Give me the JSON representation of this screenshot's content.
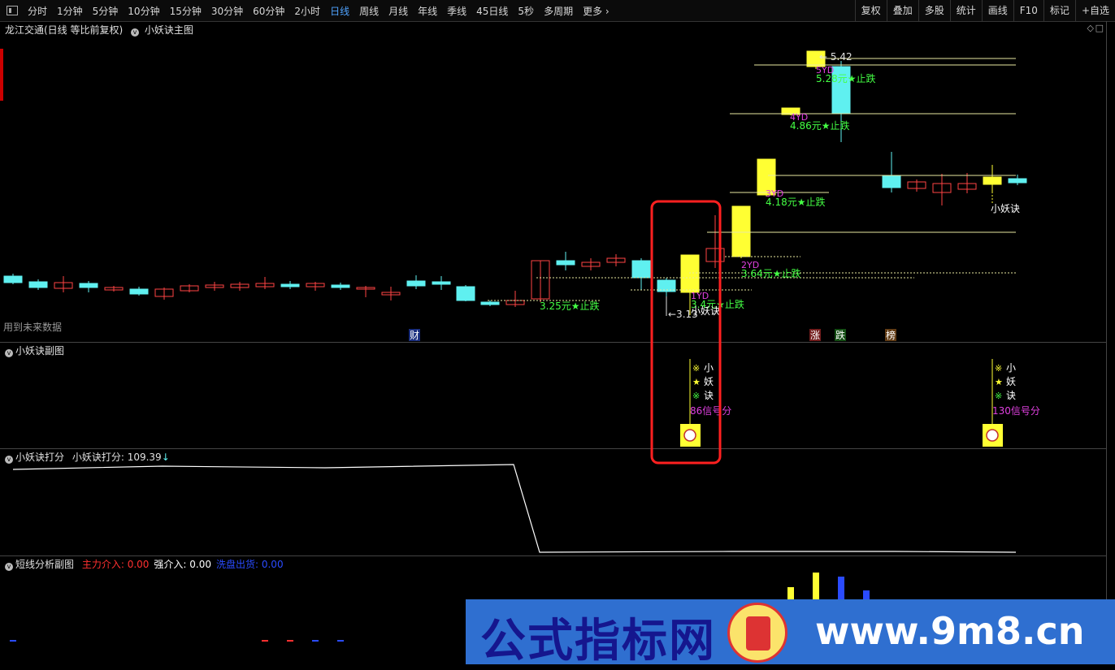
{
  "toolbar": {
    "periods": [
      "分时",
      "1分钟",
      "5分钟",
      "10分钟",
      "15分钟",
      "30分钟",
      "60分钟",
      "2小时",
      "日线",
      "周线",
      "月线",
      "年线",
      "季线",
      "45日线",
      "5秒",
      "多周期",
      "更多"
    ],
    "active": "日线",
    "right_buttons": [
      "复权",
      "叠加",
      "多股",
      "统计",
      "画线",
      "F10",
      "标记",
      "+自选"
    ]
  },
  "main_panel": {
    "stock_name": "龙江交通(日线 等比前复权)",
    "indicator_name": "小妖诀主图",
    "future_data_note": "用到未来数据",
    "price_high_label": "5.42",
    "price_low_label": "3.13",
    "axis_marker": "4",
    "signal_label_1": "小妖诀",
    "signal_label_2": "小妖诀",
    "stop_labels": [
      {
        "yd": "",
        "text": "3.25元★止跌"
      },
      {
        "yd": "1YD",
        "text": "3.4元★止跌"
      },
      {
        "yd": "2YD",
        "text": "3.64元★止跌"
      },
      {
        "yd": "3YD",
        "text": "4.18元★止跌"
      },
      {
        "yd": "4YD",
        "text": "4.86元★止跌"
      },
      {
        "yd": "5YD",
        "text": "5.28元★止跌"
      }
    ],
    "event_tags": [
      "财",
      "涨",
      "跌",
      "榜"
    ]
  },
  "sub1": {
    "title": "小妖诀副图",
    "signals": [
      {
        "chars": [
          "小",
          "妖",
          "诀"
        ],
        "marks": [
          "※",
          "★",
          "※"
        ],
        "score": "86信号分"
      },
      {
        "chars": [
          "小",
          "妖",
          "诀"
        ],
        "marks": [
          "※",
          "★",
          "※"
        ],
        "score": "130信号分"
      }
    ]
  },
  "sub2": {
    "title": "小妖诀打分",
    "value_label": "小妖诀打分: 109.39",
    "arrow": "↓"
  },
  "sub3": {
    "title": "短线分析副图",
    "items": [
      {
        "label": "主力介入: 0.00",
        "color": "#ff3030"
      },
      {
        "label": "强介入: 0.00",
        "color": "#ffffff"
      },
      {
        "label": "洗盘出货: 0.00",
        "color": "#2a4bff"
      }
    ]
  },
  "watermark": {
    "cn": "公式指标网",
    "url": "www.9m8.cn"
  },
  "colors": {
    "up": "#ff4444",
    "down": "#5ff0f0",
    "signal": "#ffff33",
    "stop_text": "#44ff44",
    "yd_text": "#e040e0",
    "highlight_box": "#ff2020"
  }
}
